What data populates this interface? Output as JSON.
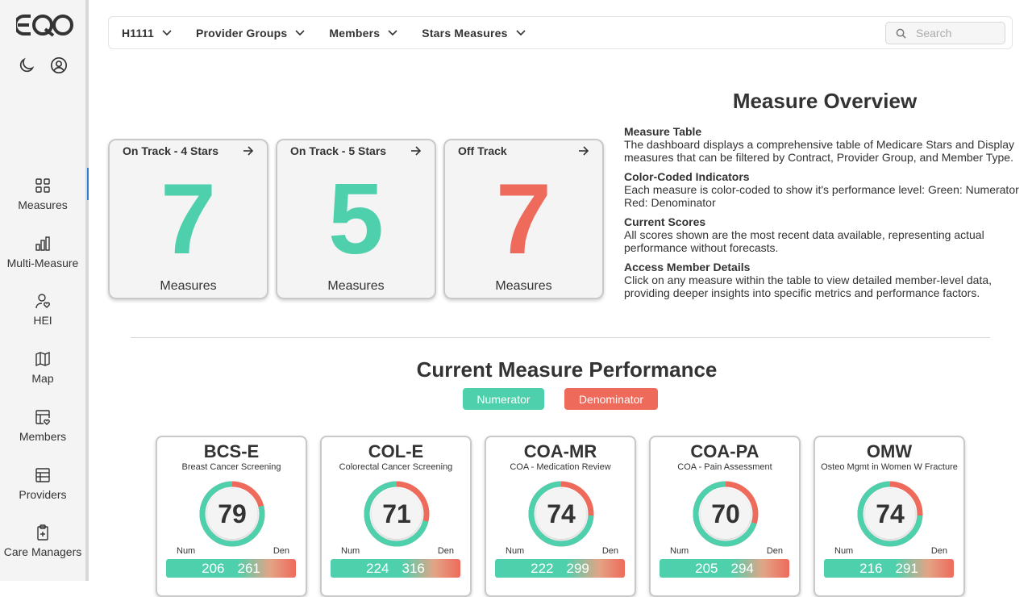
{
  "colors": {
    "green": "#4fd0ad",
    "red": "#ee6a5b",
    "accent": "#2f7fd1"
  },
  "sidebar": {
    "logo": "EQO",
    "top_icons": [
      "moon-icon",
      "user-circle-icon"
    ],
    "items": [
      {
        "label": "Measures",
        "icon": "grid-icon",
        "active": true
      },
      {
        "label": "Multi-Measure",
        "icon": "bar-chart-icon"
      },
      {
        "label": "HEI",
        "icon": "person-heart-icon"
      },
      {
        "label": "Map",
        "icon": "map-icon"
      },
      {
        "label": "Members",
        "icon": "table-heart-icon"
      },
      {
        "label": "Providers",
        "icon": "table-icon"
      },
      {
        "label": "Care Managers",
        "icon": "clipboard-plus-icon"
      }
    ]
  },
  "topbar": {
    "filters": [
      "H1111",
      "Provider Groups",
      "Members",
      "Stars Measures"
    ],
    "search_placeholder": "Search"
  },
  "stats": [
    {
      "title": "On Track - 4 Stars",
      "value": "7",
      "unit": "Measures",
      "color": "#4fd0ad"
    },
    {
      "title": "On Track - 5 Stars",
      "value": "5",
      "unit": "Measures",
      "color": "#4fd0ad"
    },
    {
      "title": "Off Track",
      "value": "7",
      "unit": "Measures",
      "color": "#ee6a5b"
    }
  ],
  "overview": {
    "title": "Measure Overview",
    "items": [
      {
        "heading": "Measure Table",
        "text": "The dashboard displays a comprehensive table of Medicare Stars and Display measures that can be filtered by Contract, Provider Group, and Member Type."
      },
      {
        "heading": "Color-Coded Indicators",
        "text": "Each measure is color-coded to show it's performance level: Green: Numerator Red: Denominator"
      },
      {
        "heading": "Current Scores",
        "text": "All scores shown are the most recent data available, representing actual performance without forecasts."
      },
      {
        "heading": "Access Member Details",
        "text": "Click on any measure within the table to view detailed member-level data, providing deeper insights into specific metrics and performance factors."
      }
    ]
  },
  "performance": {
    "title": "Current Measure Performance",
    "legend_numerator": "Numerator",
    "legend_denominator": "Denominator",
    "num_label": "Num",
    "den_label": "Den",
    "measures": [
      {
        "code": "BCS-E",
        "name": "Breast Cancer Screening",
        "score": "79",
        "numerator": "206",
        "denominator": "261"
      },
      {
        "code": "COL-E",
        "name": "Colorectal Cancer Screening",
        "score": "71",
        "numerator": "224",
        "denominator": "316"
      },
      {
        "code": "COA-MR",
        "name": "COA - Medication Review",
        "score": "74",
        "numerator": "222",
        "denominator": "299"
      },
      {
        "code": "COA-PA",
        "name": "COA - Pain Assessment",
        "score": "70",
        "numerator": "205",
        "denominator": "294"
      },
      {
        "code": "OMW",
        "name": "Osteo Mgmt in Women W Fracture",
        "score": "74",
        "numerator": "216",
        "denominator": "291"
      }
    ]
  }
}
